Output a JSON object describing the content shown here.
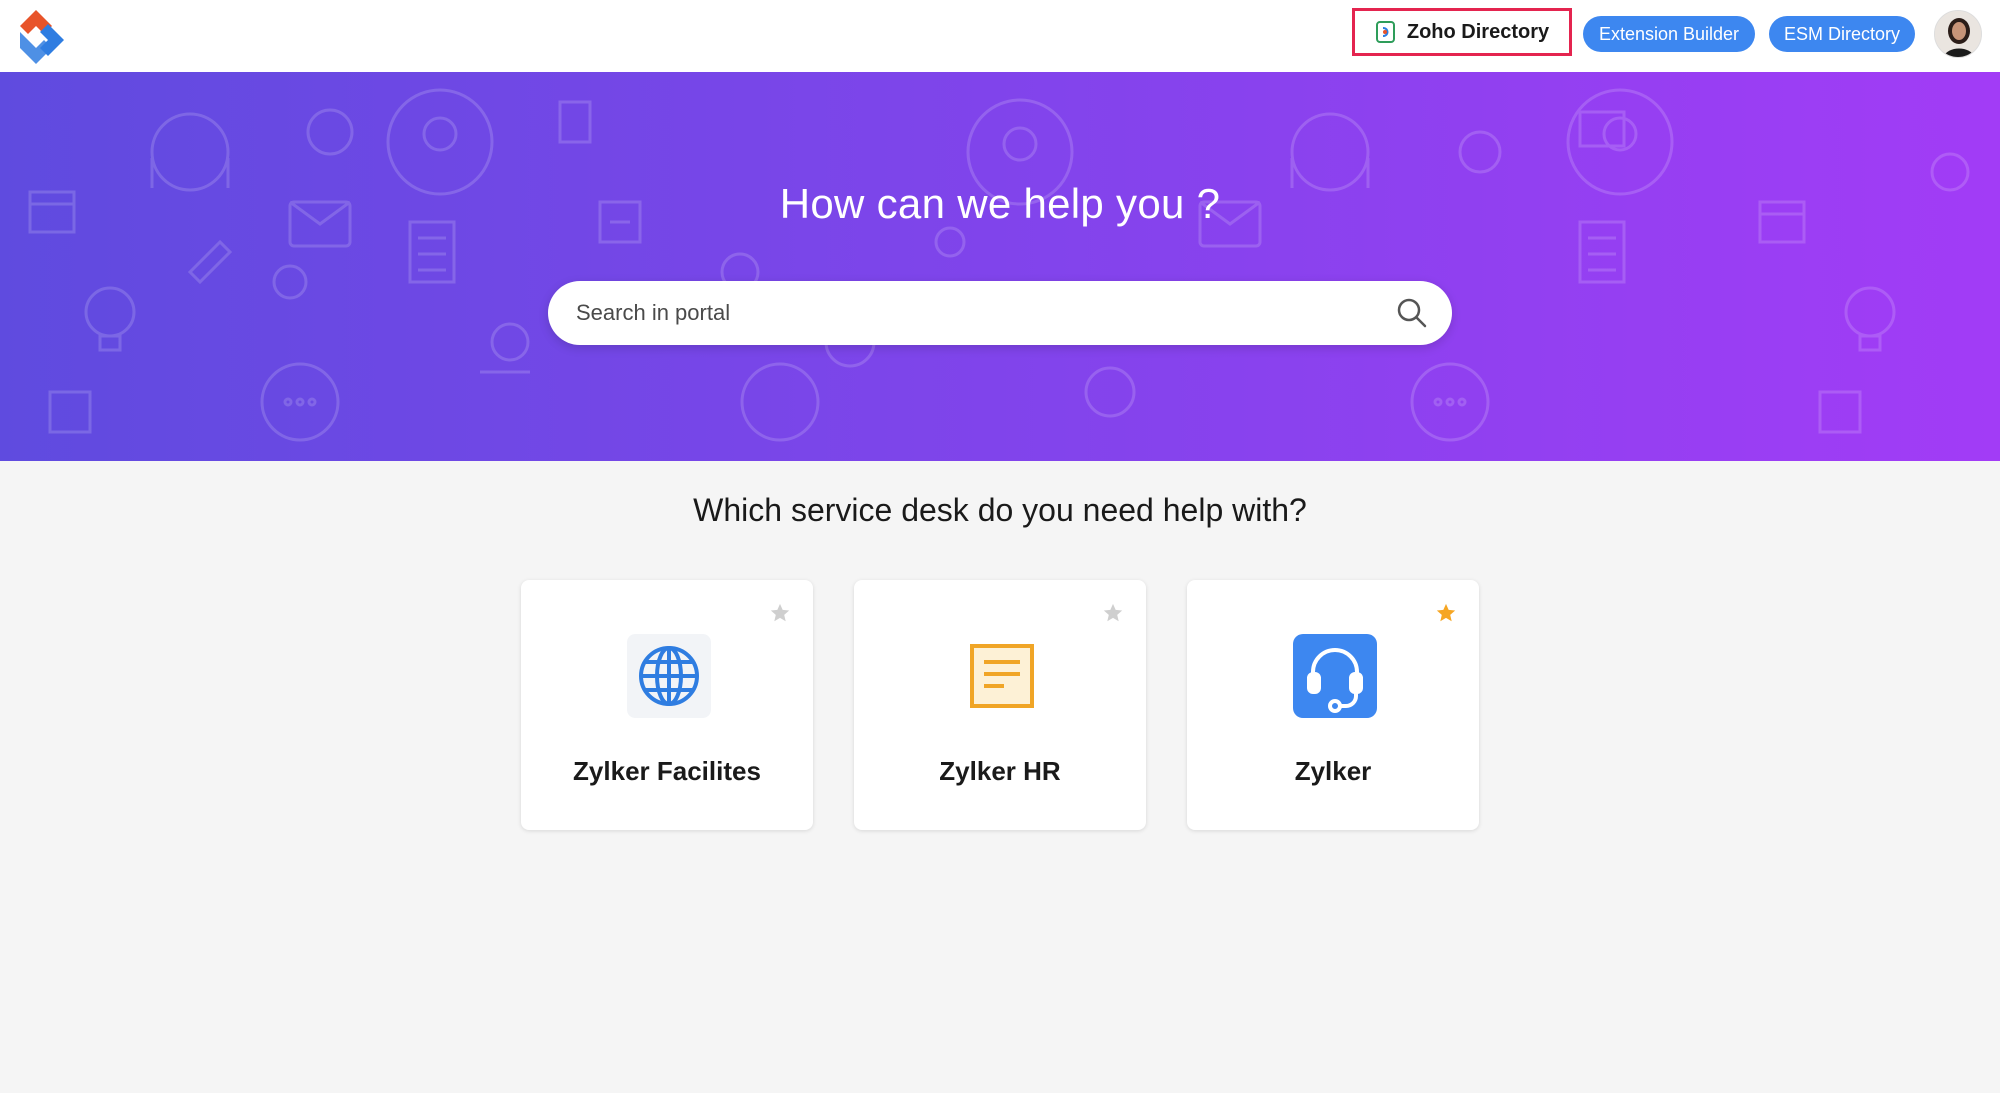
{
  "header": {
    "zoho_directory_label": "Zoho Directory",
    "extension_builder_label": "Extension Builder",
    "esm_directory_label": "ESM Directory"
  },
  "hero": {
    "title": "How can we help you ?",
    "search_placeholder": "Search in portal"
  },
  "section": {
    "title": "Which service desk do you need help with?"
  },
  "service_desks": [
    {
      "name": "Zylker Facilites",
      "icon": "globe-icon",
      "favorite": false
    },
    {
      "name": "Zylker HR",
      "icon": "document-icon",
      "favorite": false
    },
    {
      "name": "Zylker",
      "icon": "headset-icon",
      "favorite": true
    }
  ],
  "colors": {
    "accent": "#3d87f0",
    "highlight_border": "#e4244f",
    "hero_gradient_start": "#5f4bdf",
    "hero_gradient_end": "#a23cf6",
    "star_active": "#f6a623",
    "star_inactive": "#cfcfcf"
  }
}
